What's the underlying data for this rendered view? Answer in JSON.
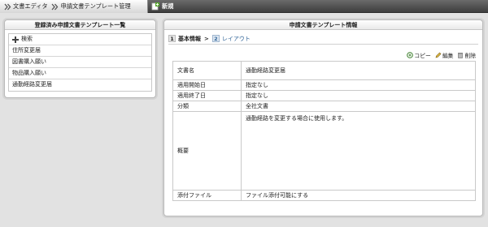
{
  "topbar": {
    "crumbs": [
      {
        "label": "文書エディタ"
      },
      {
        "label": "申請文書テンプレート管理"
      }
    ],
    "new_label": "新規"
  },
  "left_panel": {
    "title": "登録済み申請文書テンプレート一覧",
    "search_label": "検索",
    "items": [
      {
        "label": "住所変更届"
      },
      {
        "label": "図書購入願い"
      },
      {
        "label": "物品購入願い"
      },
      {
        "label": "通勤経路変更届"
      }
    ]
  },
  "right_panel": {
    "title": "申請文書テンプレート情報",
    "steps": [
      {
        "num": "1",
        "label": "基本情報"
      },
      {
        "num": "2",
        "label": "レイアウト"
      }
    ],
    "step_separator": ">",
    "toolbar": {
      "copy_label": "コピー",
      "edit_label": "編集",
      "delete_label": "削除"
    },
    "details": [
      {
        "label": "文書名",
        "value": "通勤経路変更届"
      },
      {
        "label": "適用開始日",
        "value": "指定なし"
      },
      {
        "label": "適用終了日",
        "value": "指定なし"
      },
      {
        "label": "分類",
        "value": "全社文書"
      },
      {
        "label": "概要",
        "value": "通勤経路を変更する場合に使用します。"
      },
      {
        "label": "添付ファイル",
        "value": "ファイル添付可能にする"
      }
    ]
  },
  "colors": {
    "topbar_bg": "#4e4e4e",
    "panel_bg": "#ffffff",
    "page_bg": "#e2e2e2",
    "step_link": "#336699"
  }
}
